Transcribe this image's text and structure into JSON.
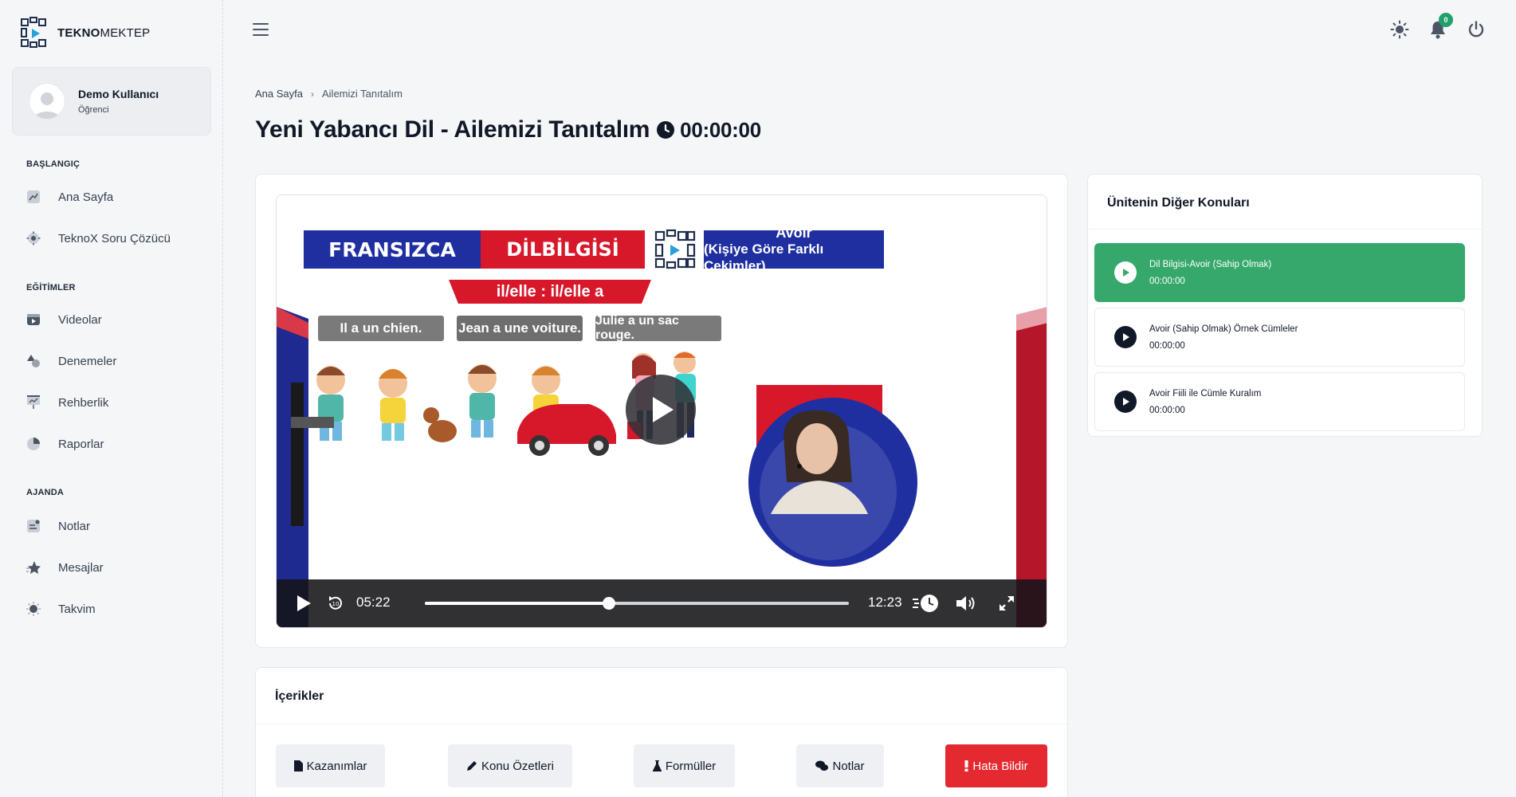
{
  "brand": {
    "name_bold": "TEKNO",
    "name_light": "MEKTEP"
  },
  "user": {
    "name": "Demo Kullanıcı",
    "role": "Öğrenci"
  },
  "sidebar": {
    "sections": [
      {
        "label": "BAŞLANGIÇ",
        "items": [
          {
            "label": "Ana Sayfa",
            "icon": "chart-icon"
          },
          {
            "label": "TeknoX Soru Çözücü",
            "icon": "cog-icon"
          }
        ]
      },
      {
        "label": "EĞİTİMLER",
        "items": [
          {
            "label": "Videolar",
            "icon": "video-icon"
          },
          {
            "label": "Denemeler",
            "icon": "shapes-icon"
          },
          {
            "label": "Rehberlik",
            "icon": "presentation-icon"
          },
          {
            "label": "Raporlar",
            "icon": "pie-icon"
          }
        ]
      },
      {
        "label": "AJANDA",
        "items": [
          {
            "label": "Notlar",
            "icon": "note-icon"
          },
          {
            "label": "Mesajlar",
            "icon": "star-icon"
          },
          {
            "label": "Takvim",
            "icon": "sun-icon"
          }
        ]
      }
    ]
  },
  "topbar": {
    "notification_count": "0"
  },
  "breadcrumb": {
    "home": "Ana Sayfa",
    "current": "Ailemizi Tanıtalım"
  },
  "page": {
    "title": "Yeni Yabancı Dil - Ailemizi Tanıtalım",
    "timer": "00:00:00"
  },
  "video": {
    "slide": {
      "banner_left": "FRANSIZCA",
      "banner_mid": "DİLBİLGİSİ",
      "banner_right_line1": "Avoir",
      "banner_right_line2": "(Kişiye Göre Farklı Çekimler)",
      "subtitle": "il/elle : il/elle a",
      "examples": [
        "Il a un chien.",
        "Jean a une voiture.",
        "Julie a un sac rouge."
      ]
    },
    "current_time": "05:22",
    "duration": "12:23",
    "progress": 0.434
  },
  "side": {
    "title": "Ünitenin Diğer Konuları",
    "topics": [
      {
        "name": "Dil Bilgisi-Avoir (Sahip Olmak)",
        "time": "00:00:00",
        "active": true
      },
      {
        "name": "Avoir (Sahip Olmak) Örnek Cümleler",
        "time": "00:00:00",
        "active": false
      },
      {
        "name": "Avoir Fiili ile Cümle Kuralım",
        "time": "00:00:00",
        "active": false
      }
    ]
  },
  "contents": {
    "title": "İçerikler",
    "buttons": {
      "kazanimlar": "Kazanımlar",
      "ozetler": "Konu Özetleri",
      "formuller": "Formüller",
      "notlar": "Notlar",
      "hata": "Hata Bildir"
    }
  },
  "colors": {
    "accent_green": "#37a86b",
    "danger_red": "#e52930",
    "banner_blue": "#1f2fa0",
    "banner_red": "#d7182a"
  }
}
